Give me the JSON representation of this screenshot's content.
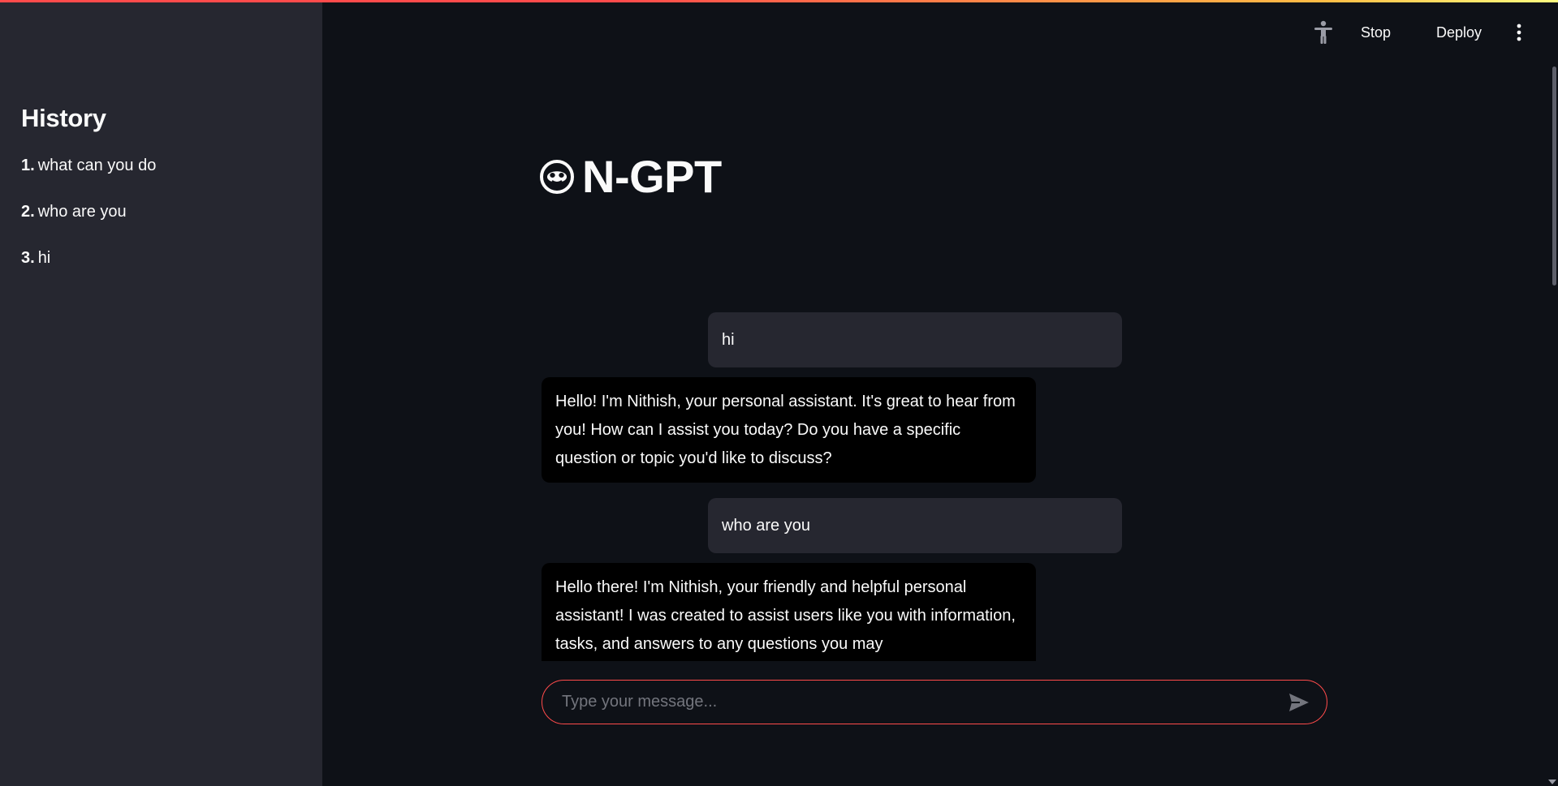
{
  "sidebar": {
    "title": "History",
    "items": [
      {
        "num": "1.",
        "label": "what can you do"
      },
      {
        "num": "2.",
        "label": "who are you"
      },
      {
        "num": "3.",
        "label": "hi"
      }
    ]
  },
  "toolbar": {
    "stop_label": "Stop",
    "deploy_label": "Deploy",
    "accessibility_icon": "accessibility-icon",
    "menu_icon": "kebab-menu-icon"
  },
  "header": {
    "emoji": "monkey-face-icon",
    "title": "N-GPT"
  },
  "messages": [
    {
      "role": "user",
      "text": "hi"
    },
    {
      "role": "assistant",
      "text": "Hello! I'm Nithish, your personal assistant. It's great to hear from you! How can I assist you today? Do you have a specific question or topic you'd like to discuss?"
    },
    {
      "role": "user",
      "text": "who are you"
    },
    {
      "role": "assistant",
      "text": "Hello there! I'm Nithish, your friendly and helpful personal assistant! I was created to assist users like you with information, tasks, and answers to any questions you may"
    }
  ],
  "chat_input": {
    "placeholder": "Type your message...",
    "value": "",
    "send_icon": "send-icon"
  },
  "colors": {
    "app_bg": "#0e1117",
    "sidebar_bg": "#262730",
    "user_bubble_bg": "#262730",
    "assistant_bubble_bg": "#000000",
    "accent": "#ff4b4b"
  }
}
